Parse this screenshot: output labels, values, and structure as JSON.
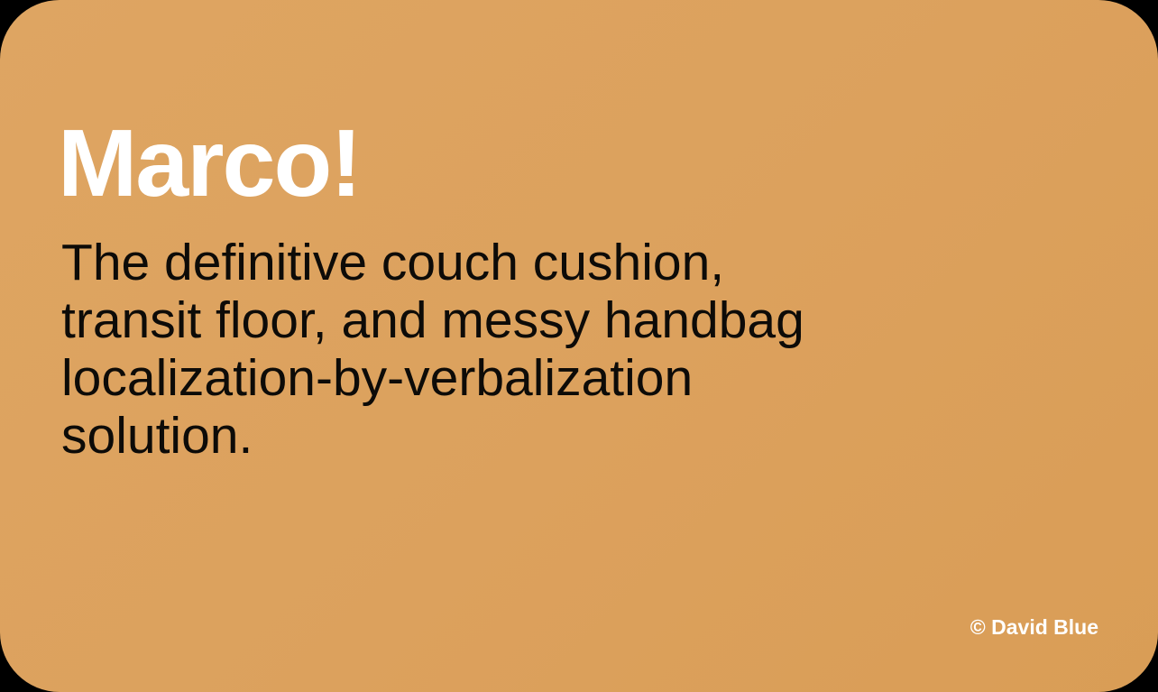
{
  "card": {
    "title": "Marco!",
    "tagline": "The definitive couch cushion,\ntransit floor, and messy handbag\nlocalization-by-verbalization\nsolution.",
    "copyright": "© David Blue"
  },
  "colors": {
    "background": "#dca15d",
    "title": "#ffffff",
    "tagline": "#0d0b08",
    "copyright": "#ffffff"
  }
}
